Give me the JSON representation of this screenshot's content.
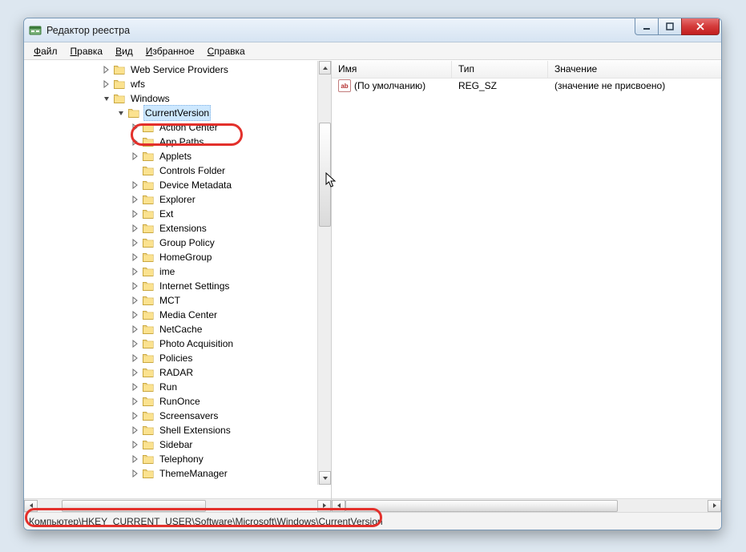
{
  "window": {
    "title": "Редактор реестра"
  },
  "menu": [
    {
      "label": "Файл",
      "accel": "Ф"
    },
    {
      "label": "Правка",
      "accel": "П"
    },
    {
      "label": "Вид",
      "accel": "В"
    },
    {
      "label": "Избранное",
      "accel": "И"
    },
    {
      "label": "Справка",
      "accel": "С"
    }
  ],
  "tree": {
    "indent_base": 95,
    "step": 18,
    "nodes": [
      {
        "level": 0,
        "expander": "closed",
        "label": "Web Service Providers"
      },
      {
        "level": 0,
        "expander": "closed",
        "label": "wfs"
      },
      {
        "level": 0,
        "expander": "open",
        "label": "Windows"
      },
      {
        "level": 1,
        "expander": "open",
        "label": "CurrentVersion",
        "selected": true
      },
      {
        "level": 2,
        "expander": "closed",
        "label": "Action Center"
      },
      {
        "level": 2,
        "expander": "closed",
        "label": "App Paths"
      },
      {
        "level": 2,
        "expander": "closed",
        "label": "Applets"
      },
      {
        "level": 2,
        "expander": "none",
        "label": "Controls Folder"
      },
      {
        "level": 2,
        "expander": "closed",
        "label": "Device Metadata"
      },
      {
        "level": 2,
        "expander": "closed",
        "label": "Explorer"
      },
      {
        "level": 2,
        "expander": "closed",
        "label": "Ext"
      },
      {
        "level": 2,
        "expander": "closed",
        "label": "Extensions"
      },
      {
        "level": 2,
        "expander": "closed",
        "label": "Group Policy"
      },
      {
        "level": 2,
        "expander": "closed",
        "label": "HomeGroup"
      },
      {
        "level": 2,
        "expander": "closed",
        "label": "ime"
      },
      {
        "level": 2,
        "expander": "closed",
        "label": "Internet Settings"
      },
      {
        "level": 2,
        "expander": "closed",
        "label": "MCT"
      },
      {
        "level": 2,
        "expander": "closed",
        "label": "Media Center"
      },
      {
        "level": 2,
        "expander": "closed",
        "label": "NetCache"
      },
      {
        "level": 2,
        "expander": "closed",
        "label": "Photo Acquisition"
      },
      {
        "level": 2,
        "expander": "closed",
        "label": "Policies"
      },
      {
        "level": 2,
        "expander": "closed",
        "label": "RADAR"
      },
      {
        "level": 2,
        "expander": "closed",
        "label": "Run"
      },
      {
        "level": 2,
        "expander": "closed",
        "label": "RunOnce"
      },
      {
        "level": 2,
        "expander": "closed",
        "label": "Screensavers"
      },
      {
        "level": 2,
        "expander": "closed",
        "label": "Shell Extensions"
      },
      {
        "level": 2,
        "expander": "closed",
        "label": "Sidebar"
      },
      {
        "level": 2,
        "expander": "closed",
        "label": "Telephony"
      },
      {
        "level": 2,
        "expander": "closed",
        "label": "ThemeManager"
      }
    ]
  },
  "value_columns": {
    "name": "Имя",
    "type": "Тип",
    "data": "Значение"
  },
  "values": [
    {
      "name": "(По умолчанию)",
      "type": "REG_SZ",
      "data": "(значение не присвоено)"
    }
  ],
  "statusbar": "Компьютер\\HKEY_CURRENT_USER\\Software\\Microsoft\\Windows\\CurrentVersion"
}
